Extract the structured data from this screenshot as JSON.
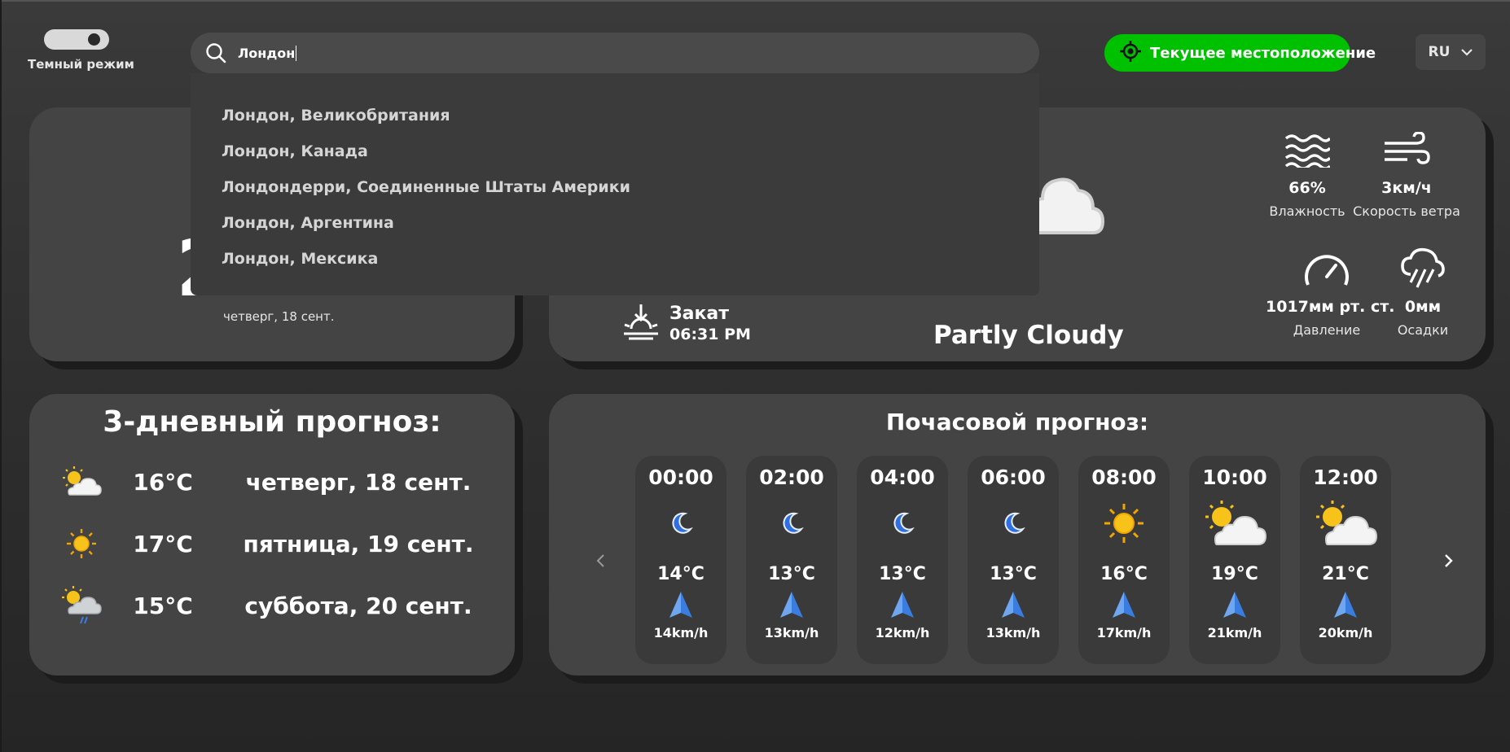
{
  "theme": {
    "toggle_label": "Темный режим",
    "accent_green": "#00c100",
    "card_bg": "#444444"
  },
  "search": {
    "value": "Лондон",
    "suggestions": [
      "Лондон, Великобритания",
      "Лондон, Канада",
      "Лондондерри, Соединенные Штаты Америки",
      "Лондон, Аргентина",
      "Лондон, Мексика"
    ]
  },
  "location_button": {
    "label": "Текущее местоположение",
    "icon": "crosshair-icon"
  },
  "language": {
    "selected": "RU"
  },
  "city_card": {
    "time_visible": "2",
    "date": "четверг, 18 сент."
  },
  "current": {
    "sunset_label": "Закат",
    "sunset_time": "06:31 PM",
    "condition": "Partly Cloudy",
    "humidity": {
      "value": "66%",
      "label": "Влажность",
      "icon": "waves-icon"
    },
    "wind": {
      "value": "3км/ч",
      "label": "Скорость ветра",
      "icon": "wind-icon"
    },
    "pressure": {
      "value": "1017мм рт. ст.",
      "label": "Давление",
      "icon": "gauge-icon"
    },
    "precipitation": {
      "value": "0мм",
      "label": "Осадки",
      "icon": "rain-cloud-icon"
    }
  },
  "forecast_3day": {
    "title": "3-дневный прогноз:",
    "days": [
      {
        "temp": "16°C",
        "date": "четверг, 18 сент.",
        "icon": "partly-cloudy-icon"
      },
      {
        "temp": "17°C",
        "date": "пятница, 19 сент.",
        "icon": "sun-icon"
      },
      {
        "temp": "15°C",
        "date": "суббота, 20 сент.",
        "icon": "rain-partly-cloudy-icon"
      }
    ]
  },
  "hourly": {
    "title": "Почасовой прогноз:",
    "hours": [
      {
        "time": "00:00",
        "temp": "14°C",
        "wind": "14km/h",
        "icon": "moon-icon"
      },
      {
        "time": "02:00",
        "temp": "13°C",
        "wind": "13km/h",
        "icon": "moon-icon"
      },
      {
        "time": "04:00",
        "temp": "13°C",
        "wind": "12km/h",
        "icon": "moon-icon"
      },
      {
        "time": "06:00",
        "temp": "13°C",
        "wind": "13km/h",
        "icon": "moon-icon"
      },
      {
        "time": "08:00",
        "temp": "16°C",
        "wind": "17km/h",
        "icon": "sun-icon"
      },
      {
        "time": "10:00",
        "temp": "19°C",
        "wind": "21km/h",
        "icon": "partly-cloudy-icon"
      },
      {
        "time": "12:00",
        "temp": "21°C",
        "wind": "20km/h",
        "icon": "partly-cloudy-icon"
      }
    ]
  }
}
